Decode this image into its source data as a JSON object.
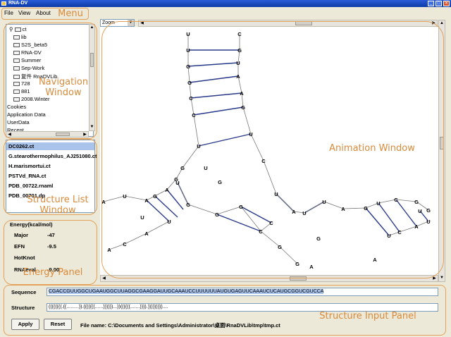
{
  "window": {
    "title": "RNA-DV",
    "buttons": {
      "minimize": "_",
      "maximize": "□",
      "close": "×"
    }
  },
  "menu": {
    "items": [
      "File",
      "View",
      "About"
    ]
  },
  "zoom": {
    "label": "Zoom"
  },
  "tree": {
    "root": "ct",
    "items": [
      "lib",
      "S2S_beta5",
      "RNA-DV",
      "Summer",
      "Sep-Work",
      "复件 RnaDVLib",
      "728",
      "881",
      "2008.Winter"
    ],
    "outer_items": [
      "Cookies",
      "Application Data",
      "UserData",
      "Recent"
    ]
  },
  "structure_list": {
    "items": [
      "DC0262.ct",
      "G.stearothermophilus_AJ251080.ct",
      "H.marismortui.ct",
      "PSTVd_RNA.ct",
      "PDB_00722.rnaml",
      "PDB_00701.dp"
    ]
  },
  "energy": {
    "title": "Energy(kcal/mol)",
    "rows": [
      {
        "label": "Major",
        "value": "-47"
      },
      {
        "label": "EFN",
        "value": "-9.5"
      },
      {
        "label": "HotKnot",
        "value": ""
      },
      {
        "label": "RNAeval",
        "value": "-9.00"
      }
    ]
  },
  "input_panel": {
    "sequence_label": "Sequence",
    "sequence_value": "CGACCGUUGGCUGAAUGGCUUAGGCGAAGGAUUGCAAAUCCUUUUUUAUGUGAGUUCAAAUCUCAUGCGGUCGUCCA",
    "structure_label": "Structure",
    "structure_value": "((((((((.((.........)).(((((((......))))))...))((((((.......)))).)))))))))....",
    "apply_label": "Apply",
    "reset_label": "Reset",
    "filename": "File name: C:\\Documents and Settings\\Administrator\\桌面\\RnaDVLib\\tmp\\tmp.ct"
  },
  "annotations": {
    "menu": "Menu",
    "navigation": "Navigation\nWindow",
    "structure_list": "Structure List\nWindow",
    "energy": "Energy Panel",
    "animation": "Animation Window",
    "input": "Structure Input Panel"
  },
  "colors": {
    "annotation": "#e3a15a",
    "bond": "#2a3a8a",
    "backbone": "#777777",
    "highlight": "#a9c3ea"
  },
  "rna_nodes": [
    "U",
    "U",
    "G",
    "G",
    "C",
    "C",
    "U",
    "G",
    "G",
    "C",
    "G",
    "U",
    "A",
    "A",
    "G",
    "U",
    "C",
    "U",
    "A",
    "U",
    "U",
    "A",
    "G",
    "U",
    "C",
    "G",
    "G",
    "A",
    "G",
    "A",
    "U",
    "A",
    "U",
    "G",
    "G",
    "G",
    "C",
    "C",
    "U",
    "A",
    "C",
    "A",
    "G",
    "G",
    "U",
    "C",
    "A",
    "U",
    "U",
    "G",
    "A",
    "A",
    "U",
    "G",
    "U"
  ]
}
